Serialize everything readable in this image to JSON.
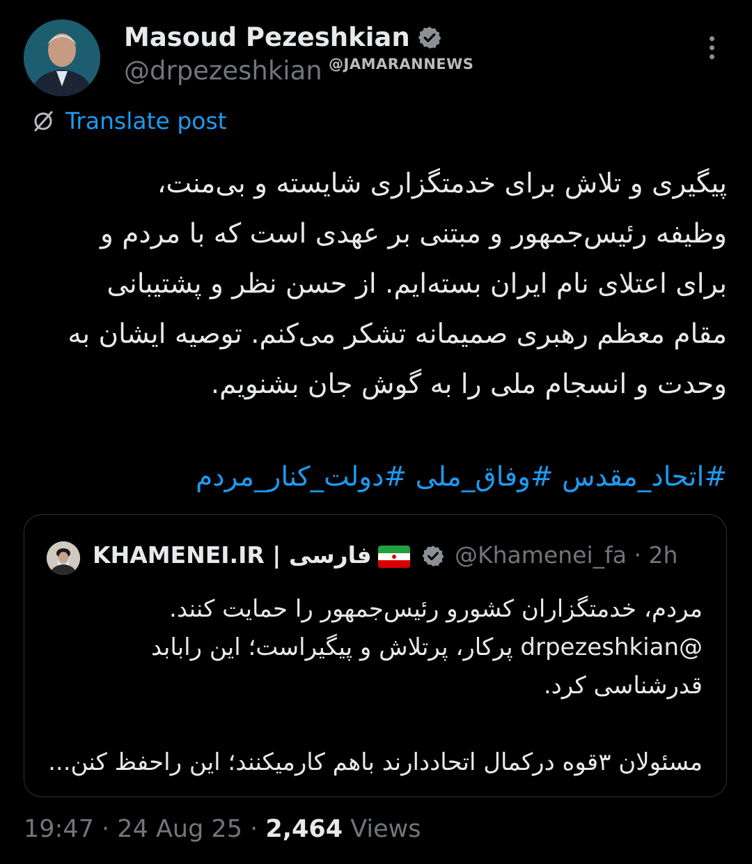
{
  "author": {
    "display_name": "Masoud Pezeshkian",
    "handle": "@drpezeshkian"
  },
  "watermark": "@JAMARANNEWS",
  "translate_label": "Translate post",
  "post": {
    "lines": [
      "پیگیری و تلاش برای خدمتگزاری شایسته و بی‌منت،",
      "وظیفه رئیس‌جمهور و مبتنی بر عهدی است که با مردم و",
      "برای اعتلای نام ایران بسته‌ایم. از حسن نظر و پشتیبانی",
      "مقام معظم رهبری صمیمانه تشکر می‌کنم. توصیه ایشان به",
      "وحدت و انسجام ملی را به گوش جان بشنویم."
    ],
    "hashtags": "#اتحاد_مقدس #وفاق_ملی #دولت_کنار_مردم"
  },
  "quote": {
    "display_name": "KHAMENEI.IR | فارسی",
    "handle": "@Khamenei_fa",
    "time": "2h",
    "lines": [
      "مردم، خدمتگزاران کشورو رئیس‌جمهور را حمایت کنند.",
      "@drpezeshkian پرکار، پرتلاش و پیگیراست؛ این رابابد",
      "قدرشناسی کرد.",
      "",
      "مسئولان ۳قوه درکمال اتحاددارند باهم کارمیکنند؛ این راحفظ کنن..."
    ]
  },
  "footer": {
    "time": "19:47",
    "date": "24 Aug 25",
    "views_count": "2,464",
    "views_label": "Views",
    "separator": "·"
  },
  "colors": {
    "background": "#000000",
    "text": "#e7e9ea",
    "muted": "#71767b",
    "link": "#1d9bf0",
    "border": "#2f3336"
  },
  "icons": [
    "verified-badge-icon",
    "more-options-icon",
    "translate-icon",
    "iran-flag-icon"
  ]
}
